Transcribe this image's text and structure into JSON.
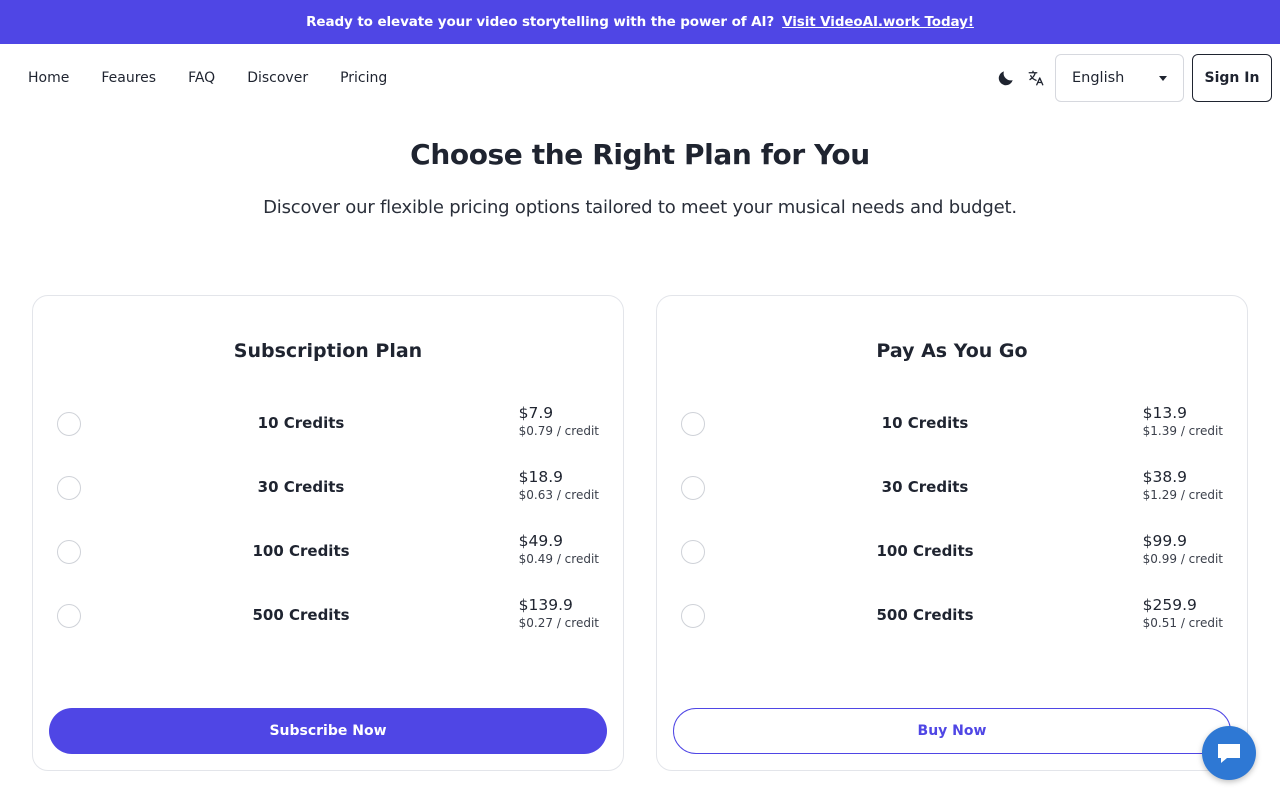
{
  "banner": {
    "text": "Ready to elevate your video storytelling with the power of AI?",
    "link": "Visit VideoAI.work Today!"
  },
  "nav": {
    "links": [
      "Home",
      "Feaures",
      "FAQ",
      "Discover",
      "Pricing"
    ],
    "language": "English",
    "signin": "Sign In"
  },
  "hero": {
    "title": "Choose the Right Plan for You",
    "subtitle": "Discover our flexible pricing options tailored to meet your musical needs and budget."
  },
  "plans": [
    {
      "title": "Subscription Plan",
      "button": "Subscribe Now",
      "options": [
        {
          "credits": "10 Credits",
          "price": "$7.9",
          "per": "$0.79 / credit"
        },
        {
          "credits": "30 Credits",
          "price": "$18.9",
          "per": "$0.63 / credit"
        },
        {
          "credits": "100 Credits",
          "price": "$49.9",
          "per": "$0.49 / credit"
        },
        {
          "credits": "500 Credits",
          "price": "$139.9",
          "per": "$0.27 / credit"
        }
      ]
    },
    {
      "title": "Pay As You Go",
      "button": "Buy Now",
      "options": [
        {
          "credits": "10 Credits",
          "price": "$13.9",
          "per": "$1.39 / credit"
        },
        {
          "credits": "30 Credits",
          "price": "$38.9",
          "per": "$1.29 / credit"
        },
        {
          "credits": "100 Credits",
          "price": "$99.9",
          "per": "$0.99 / credit"
        },
        {
          "credits": "500 Credits",
          "price": "$259.9",
          "per": "$0.51 / credit"
        }
      ]
    }
  ],
  "colors": {
    "accent": "#4f46e5",
    "chat": "#2e78d4"
  },
  "icons": [
    "moon-icon",
    "translate-icon",
    "chevron-down-icon",
    "chat-icon"
  ]
}
